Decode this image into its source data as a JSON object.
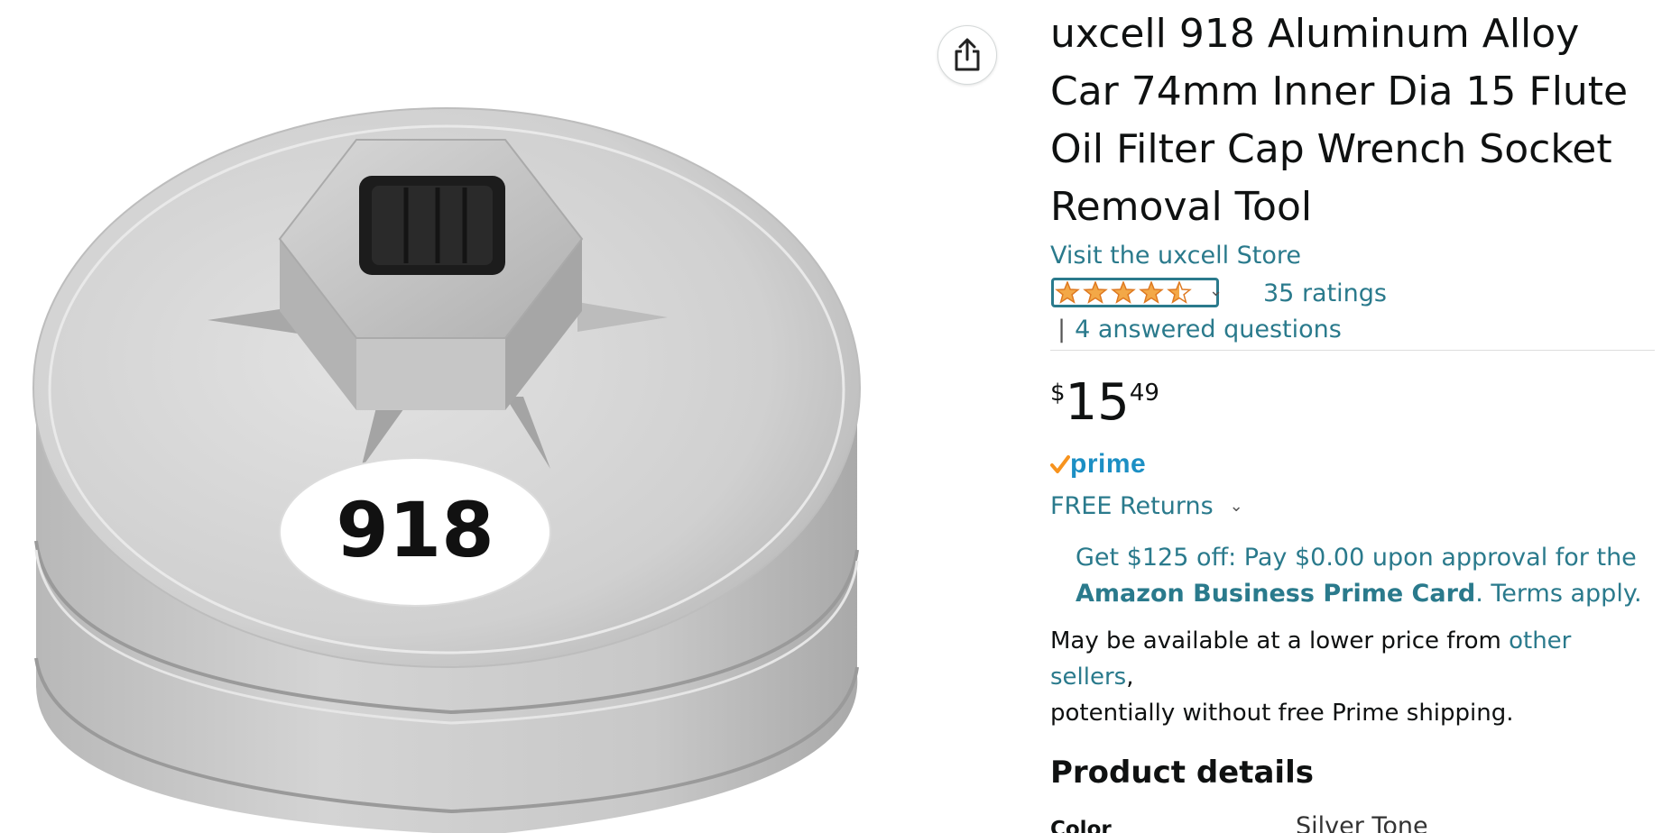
{
  "product": {
    "sticker_label": "918",
    "title_lines": [
      "uxcell 918 Aluminum Alloy",
      "Car 74mm Inner Dia 15 Flute",
      "Oil Filter Cap Wrench Socket",
      "Removal Tool"
    ],
    "store_link": "Visit the uxcell Store"
  },
  "share": {
    "icon": "share-icon"
  },
  "ratings": {
    "stars": 4.5,
    "star_color": "#f3a847",
    "ratings_label": "35 ratings",
    "separator": "|",
    "questions_label": "4 answered questions"
  },
  "price": {
    "symbol": "$",
    "whole": "15",
    "fraction": "49"
  },
  "prime": {
    "label": "prime",
    "check_color": "#f7931e",
    "text_color": "#1c8fc4"
  },
  "returns": {
    "label": "FREE Returns"
  },
  "promo": {
    "line1": "Get $125 off: Pay $0.00 upon approval for the",
    "card_name": "Amazon Business Prime Card",
    "terms": ". Terms apply."
  },
  "availability": {
    "text_before": "May be available at a lower price from ",
    "link": "other sellers",
    "text_after": ",",
    "line2": "potentially without free Prime shipping."
  },
  "details": {
    "heading": "Product details",
    "rows": [
      {
        "key": "Color",
        "value": "Silver Tone"
      }
    ]
  },
  "colors": {
    "link": "#2a7a8c",
    "text": "#0f1111"
  }
}
